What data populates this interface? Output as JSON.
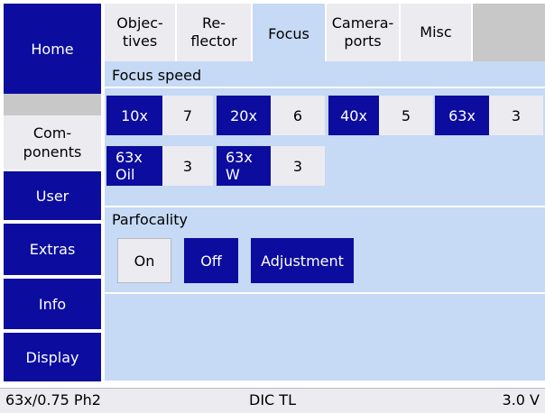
{
  "nav": {
    "home": "Home",
    "components": [
      "Com-",
      "ponents"
    ],
    "user": "User",
    "extras": "Extras",
    "info": "Info",
    "display": "Display"
  },
  "tabs": [
    {
      "lines": [
        "Objec-",
        "tives"
      ]
    },
    {
      "lines": [
        "Re-",
        "flector"
      ]
    },
    {
      "lines": [
        "Focus"
      ],
      "active": true
    },
    {
      "lines": [
        "Camera-",
        "ports"
      ]
    },
    {
      "lines": [
        "Misc"
      ]
    }
  ],
  "focus_speed": {
    "title": "Focus speed",
    "items": [
      {
        "objective": [
          "10x"
        ],
        "speed": "7"
      },
      {
        "objective": [
          "20x"
        ],
        "speed": "6"
      },
      {
        "objective": [
          "40x"
        ],
        "speed": "5"
      },
      {
        "objective": [
          "63x"
        ],
        "speed": "3"
      },
      {
        "objective": [
          "63x",
          "Oil"
        ],
        "speed": "3"
      },
      {
        "objective": [
          "63x",
          "W"
        ],
        "speed": "3"
      }
    ]
  },
  "parfocality": {
    "title": "Parfocality",
    "on": "On",
    "off": "Off",
    "adjustment": "Adjustment",
    "selected": "On"
  },
  "status": {
    "objective": "63x/0.75 Ph2",
    "contrast": "DIC TL",
    "voltage": "3.0 V"
  },
  "colors": {
    "nav_blue": "#0c0c9f",
    "panel": "#c6d9f5",
    "button_grey": "#ecebf0"
  }
}
